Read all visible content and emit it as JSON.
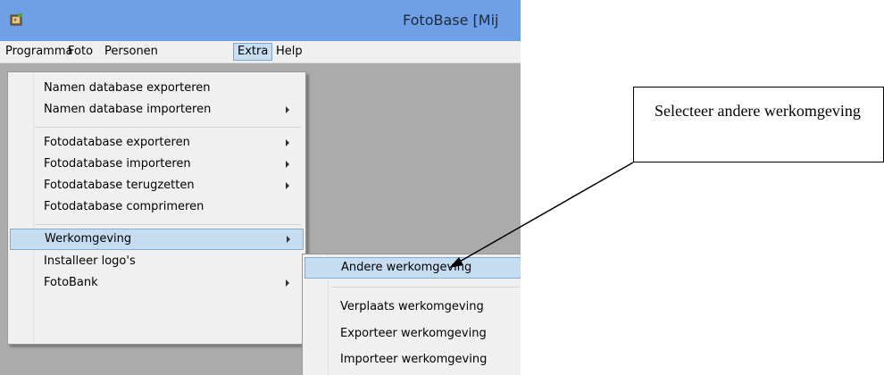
{
  "window": {
    "title": "FotoBase [Mij",
    "titlebar_color": "#6f9fe6",
    "icon": "fotobase-app-icon"
  },
  "menubar": {
    "items": [
      "Programma",
      "Foto",
      "Personen",
      "Extra",
      "Help"
    ],
    "open_item": "Extra"
  },
  "extra_menu": {
    "items": [
      {
        "label": "Namen database exporteren",
        "has_submenu": false
      },
      {
        "label": "Namen database importeren",
        "has_submenu": true
      },
      {
        "label": "Fotodatabase exporteren",
        "has_submenu": true
      },
      {
        "label": "Fotodatabase importeren",
        "has_submenu": true
      },
      {
        "label": "Fotodatabase terugzetten",
        "has_submenu": true
      },
      {
        "label": "Fotodatabase comprimeren",
        "has_submenu": false
      },
      {
        "label": "Werkomgeving",
        "has_submenu": true,
        "highlighted": true
      },
      {
        "label": "Installeer logo's",
        "has_submenu": false
      },
      {
        "label": "FotoBank",
        "has_submenu": true
      }
    ]
  },
  "werkomgeving_submenu": {
    "items": [
      {
        "label": "Andere werkomgeving",
        "highlighted": true
      },
      {
        "label": "Verplaats werkomgeving"
      },
      {
        "label": "Exporteer werkomgeving"
      },
      {
        "label": "Importeer werkomgeving"
      }
    ]
  },
  "callout": {
    "text": "Selecteer andere werkomgeving"
  },
  "colors": {
    "highlight": "#c6dcf1",
    "menu_background": "#f0f0f0",
    "client_area": "#ababab"
  }
}
